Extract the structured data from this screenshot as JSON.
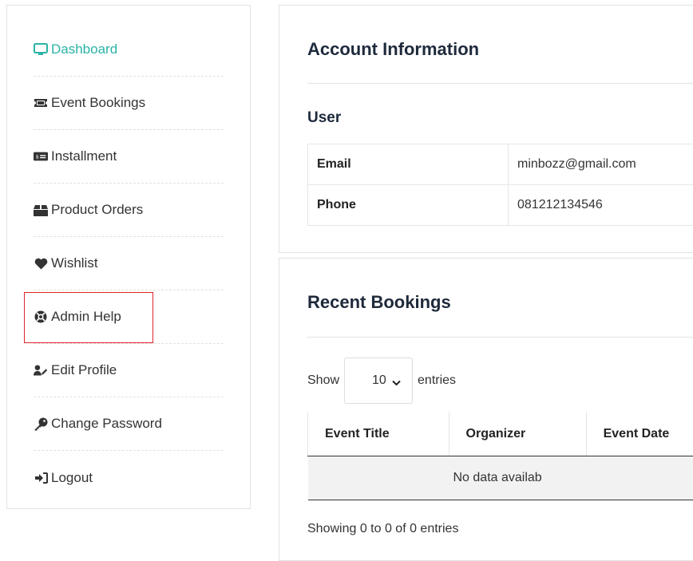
{
  "sidebar": {
    "items": [
      {
        "label": "Dashboard",
        "icon": "monitor-icon"
      },
      {
        "label": "Event Bookings",
        "icon": "ticket-icon"
      },
      {
        "label": "Installment",
        "icon": "money-bill-icon"
      },
      {
        "label": "Product Orders",
        "icon": "box-icon"
      },
      {
        "label": "Wishlist",
        "icon": "heart-icon"
      },
      {
        "label": "Admin Help",
        "icon": "lifebuoy-icon"
      },
      {
        "label": "Edit Profile",
        "icon": "user-edit-icon"
      },
      {
        "label": "Change Password",
        "icon": "key-icon"
      },
      {
        "label": "Logout",
        "icon": "sign-out-icon"
      }
    ],
    "active_color": "#2ab3a6",
    "highlight_color": "#e0252b"
  },
  "account": {
    "title": "Account Information",
    "section": "User",
    "rows": [
      {
        "key": "Email",
        "value": "minbozz@gmail.com"
      },
      {
        "key": "Phone",
        "value": "081212134546"
      }
    ]
  },
  "bookings": {
    "title": "Recent Bookings",
    "show_label": "Show",
    "entries_value": "10",
    "entries_label": "entries",
    "columns": [
      "Event Title",
      "Organizer",
      "Event Date"
    ],
    "empty_text": "No data availab",
    "info": "Showing 0 to 0 of 0 entries"
  }
}
